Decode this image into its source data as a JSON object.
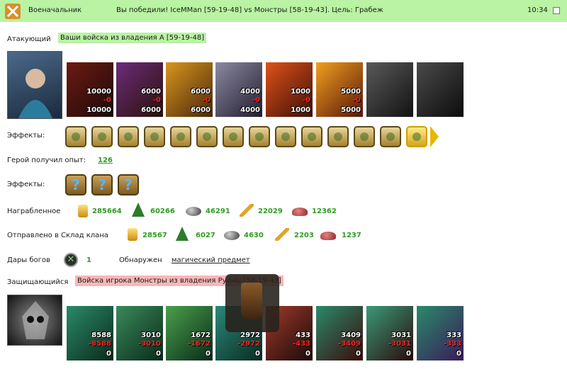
{
  "header": {
    "role": "Военачальник",
    "message": "Вы победили! IceMMan [59-19-48] vs Монстры [58-19-43]. Цель: Грабеж",
    "time": "10:34"
  },
  "attacker": {
    "label": "Атакующий",
    "tag": "Ваши войска из владения A [59-19-48]",
    "units": [
      {
        "top": "10000",
        "mid": "-0",
        "bottom": "10000"
      },
      {
        "top": "6000",
        "mid": "-0",
        "bottom": "6000"
      },
      {
        "top": "6000",
        "mid": "-0",
        "bottom": "6000"
      },
      {
        "top": "4000",
        "mid": "-0",
        "bottom": "4000"
      },
      {
        "top": "1000",
        "mid": "-0",
        "bottom": "1000"
      },
      {
        "top": "5000",
        "mid": "-0",
        "bottom": "5000"
      },
      {
        "top": "",
        "mid": "",
        "bottom": ""
      },
      {
        "top": "",
        "mid": "",
        "bottom": ""
      }
    ]
  },
  "effects_label": "Эффекты:",
  "hero_exp": {
    "label": "Герой получил опыт:",
    "value": "126"
  },
  "effects2_label": "Эффекты:",
  "looted": {
    "label": "Награбленное",
    "gold": "285664",
    "wood": "60266",
    "ore": "46291",
    "wheat": "22029",
    "gems": "12362"
  },
  "clan": {
    "label": "Отправлено в Склад клана",
    "gold": "28567",
    "wood": "6027",
    "ore": "4630",
    "wheat": "2203",
    "gems": "1237"
  },
  "gifts": {
    "label": "Дары богов",
    "value": "1",
    "found_label": "Обнаружен",
    "found_item": "магический предмет"
  },
  "defender": {
    "label": "Защищающийся",
    "tag": "Войска игрока Монстры из владения Руины [58-19-43]",
    "units": [
      {
        "top": "8588",
        "mid": "-8588",
        "bottom": "0"
      },
      {
        "top": "3010",
        "mid": "-3010",
        "bottom": "0"
      },
      {
        "top": "1672",
        "mid": "-1672",
        "bottom": "0"
      },
      {
        "top": "2972",
        "mid": "-2972",
        "bottom": "0"
      },
      {
        "top": "433",
        "mid": "-433",
        "bottom": "0"
      },
      {
        "top": "3409",
        "mid": "-3409",
        "bottom": "0"
      },
      {
        "top": "3031",
        "mid": "-3031",
        "bottom": "0"
      },
      {
        "top": "333",
        "mid": "-333",
        "bottom": "0"
      }
    ]
  }
}
